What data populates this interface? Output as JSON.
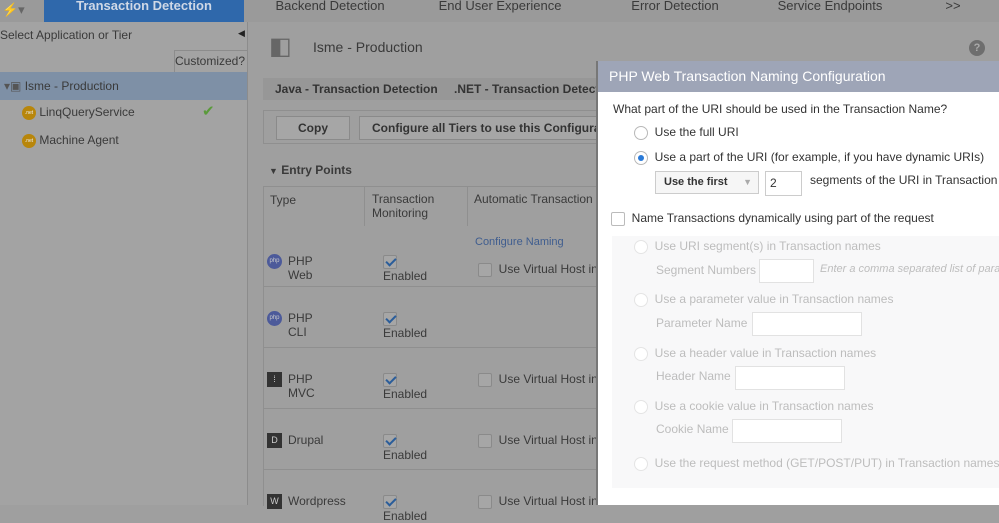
{
  "tabs": [
    {
      "label": "Transaction Detection",
      "active": true
    },
    {
      "label": "Backend Detection"
    },
    {
      "label": "End User Experience"
    },
    {
      "label": "Error Detection"
    },
    {
      "label": "Service Endpoints"
    },
    {
      "label": ">>"
    }
  ],
  "sidebar": {
    "title": "Select Application or Tier",
    "column": "Customized?",
    "items": [
      {
        "label": "Isme - Production",
        "selected": true
      },
      {
        "label": "LinqQueryService",
        "customized": true
      },
      {
        "label": "Machine Agent"
      }
    ]
  },
  "main": {
    "title": "Isme - Production",
    "subtabs": [
      "Java - Transaction Detection",
      ".NET - Transaction Detecti"
    ],
    "copy": "Copy",
    "configure_all": "Configure all Tiers to use this Configurati",
    "section": "Entry Points",
    "columns": [
      "Type",
      "Transaction Monitoring",
      "Automatic Transaction D"
    ],
    "configure_naming": "Configure Naming",
    "rows": [
      {
        "type": "PHP Web",
        "enabled": "Enabled",
        "vhost": "Use Virtual Host in"
      },
      {
        "type": "PHP CLI",
        "enabled": "Enabled",
        "vhost": ""
      },
      {
        "type": "PHP MVC",
        "enabled": "Enabled",
        "vhost": "Use Virtual Host in"
      },
      {
        "type": "Drupal",
        "enabled": "Enabled",
        "vhost": "Use Virtual Host in"
      },
      {
        "type": "Wordpress",
        "enabled": "Enabled",
        "vhost": "Use Virtual Host in"
      }
    ]
  },
  "dialog": {
    "title": "PHP Web Transaction Naming Configuration",
    "question": "What part of the URI should be used in the Transaction Name?",
    "opt_full": "Use the full URI",
    "opt_part": "Use a part of the URI (for example, if you have dynamic URIs)",
    "select_value": "Use the first",
    "segments_value": "2",
    "segments_suffix": "segments of the URI in Transaction Na",
    "dynamic": "Name Transactions dynamically using part of the request",
    "opt_segment": "Use URI segment(s) in Transaction names",
    "segment_label": "Segment Numbers",
    "segment_placeholder": "Enter a comma separated list of para",
    "opt_param": "Use a parameter value in Transaction names",
    "param_label": "Parameter Name",
    "opt_header": "Use a header value in Transaction names",
    "header_label": "Header Name",
    "opt_cookie": "Use a cookie value in Transaction names",
    "cookie_label": "Cookie Name",
    "opt_method": "Use the request method (GET/POST/PUT) in Transaction names"
  },
  "colors": {
    "accent": "#2f68ab",
    "radio_selected": "#2a7ad8",
    "check": "#6ab04c"
  }
}
